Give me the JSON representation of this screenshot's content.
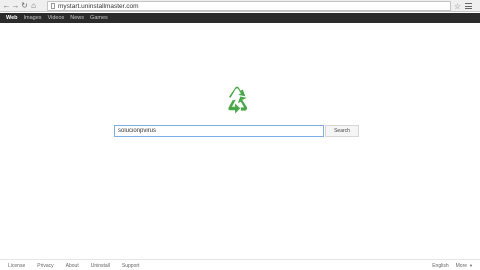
{
  "browser": {
    "url": "mystart.uninstallmaster.com",
    "icons": {
      "back": "back-arrow-icon",
      "forward": "forward-arrow-icon",
      "reload": "reload-icon",
      "home": "home-icon",
      "star": "star-icon",
      "menu": "menu-icon"
    }
  },
  "nav": {
    "items": [
      {
        "label": "Web",
        "active": true
      },
      {
        "label": "Images"
      },
      {
        "label": "Videos"
      },
      {
        "label": "News"
      },
      {
        "label": "Games"
      }
    ]
  },
  "logo": {
    "icon": "recycle-icon",
    "color": "#4aa84a"
  },
  "search": {
    "value": "solucionpvirus",
    "button_label": "Search",
    "border_color": "#7eaee6"
  },
  "footer": {
    "links": [
      "License",
      "Privacy",
      "About",
      "Uninstall",
      "Support"
    ],
    "language": "English",
    "more": "More"
  },
  "colors": {
    "nav_bg": "#2b2b2b",
    "toolbar_bg": "#efefef"
  }
}
